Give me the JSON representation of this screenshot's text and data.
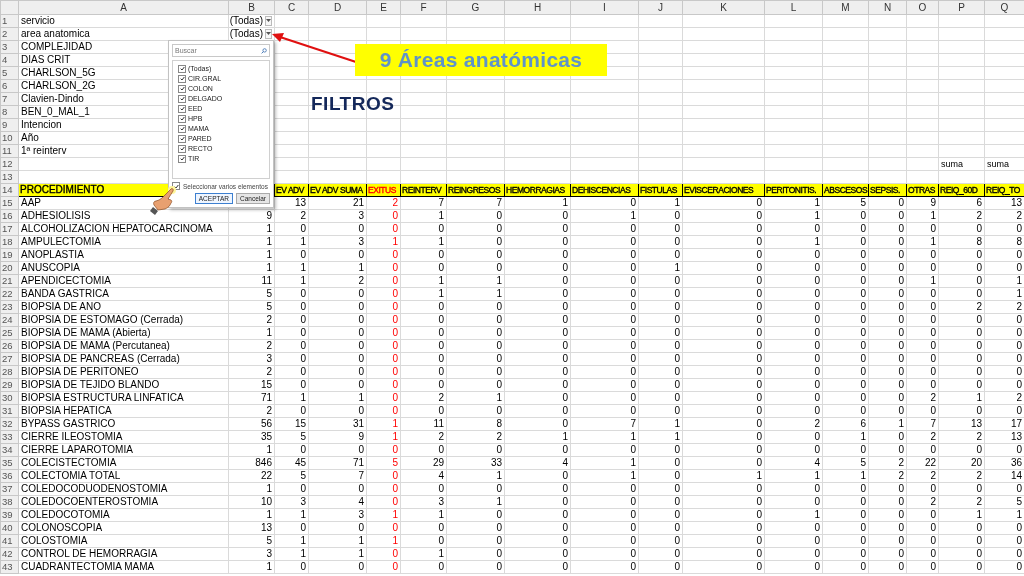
{
  "sheet": {
    "column_letters": [
      "A",
      "B",
      "C",
      "D",
      "E",
      "F",
      "G",
      "H",
      "I",
      "J",
      "K",
      "L",
      "M",
      "N",
      "O",
      "P",
      "Q"
    ]
  },
  "filters": [
    {
      "number": "1",
      "label": "servicio",
      "value": "(Todas)"
    },
    {
      "number": "2",
      "label": "area anatomica",
      "value": "(Todas)"
    },
    {
      "number": "3",
      "label": "COMPLEJIDAD"
    },
    {
      "number": "4",
      "label": "DIAS CRIT"
    },
    {
      "number": "5",
      "label": "CHARLSON_5G"
    },
    {
      "number": "6",
      "label": "CHARLSON_2G"
    },
    {
      "number": "7",
      "label": "Clavien-Dindo"
    },
    {
      "number": "8",
      "label": "BEN_0_MAL_1"
    },
    {
      "number": "9",
      "label": "Intencion"
    },
    {
      "number": "10",
      "label": "Año"
    },
    {
      "number": "11",
      "label": "1ª reinterv"
    }
  ],
  "row_12": {
    "number": "12",
    "values": [
      "suma",
      "suma"
    ]
  },
  "row_13": {
    "number": "13"
  },
  "table": {
    "header_number": "14",
    "header_label": "PROCEDIMIENTO",
    "columns": [
      {
        "label": "EV ADV",
        "flagged": false
      },
      {
        "label": "EV ADV SUMA",
        "flagged": false
      },
      {
        "label": "EXITUS",
        "flagged": true
      },
      {
        "label": "REINTERV",
        "flagged": false
      },
      {
        "label": "REINGRESOS",
        "flagged": false
      },
      {
        "label": "HEMORRAGIAS",
        "flagged": false
      },
      {
        "label": "DEHISCENCIAS",
        "flagged": false
      },
      {
        "label": "FISTULAS",
        "flagged": false
      },
      {
        "label": "EVISCERACIONES",
        "flagged": false
      },
      {
        "label": "PERITONITIS.",
        "flagged": false
      },
      {
        "label": "ABSCESOS",
        "flagged": false
      },
      {
        "label": "SEPSIS.",
        "flagged": false
      },
      {
        "label": "OTRAS",
        "flagged": false
      },
      {
        "label": "REIQ_60D",
        "flagged": false
      },
      {
        "label": "REIQ_TO",
        "flagged": false
      }
    ],
    "rows": [
      {
        "number": "15",
        "label": "AAP",
        "values": [
          "13",
          "21",
          "2",
          "7",
          "7",
          "1",
          "0",
          "1",
          "0",
          "1",
          "5",
          "0",
          "9",
          "6",
          "13"
        ]
      },
      {
        "number": "16",
        "label": "ADHESIOLISIS",
        "values": [
          "9",
          "2",
          "3",
          "0",
          "1",
          "0",
          "0",
          "1",
          "0",
          "0",
          "1",
          "0",
          "0",
          "1",
          "2",
          "2"
        ]
      },
      {
        "number": "17",
        "label": "ALCOHOLIZACION HEPATOCARCINOMA",
        "values": [
          "1",
          "0",
          "0",
          "0",
          "0",
          "0",
          "0",
          "0",
          "0",
          "0",
          "0",
          "0",
          "0",
          "0",
          "0",
          "0"
        ]
      },
      {
        "number": "18",
        "label": "AMPULECTOMIA",
        "values": [
          "1",
          "1",
          "3",
          "1",
          "1",
          "0",
          "0",
          "0",
          "0",
          "0",
          "1",
          "0",
          "0",
          "1",
          "8",
          "8"
        ]
      },
      {
        "number": "19",
        "label": "ANOPLASTIA",
        "values": [
          "1",
          "0",
          "0",
          "0",
          "0",
          "0",
          "0",
          "0",
          "0",
          "0",
          "0",
          "0",
          "0",
          "0",
          "0",
          "0"
        ]
      },
      {
        "number": "20",
        "label": "ANUSCOPIA",
        "values": [
          "1",
          "1",
          "1",
          "0",
          "0",
          "0",
          "0",
          "0",
          "1",
          "0",
          "0",
          "0",
          "0",
          "0",
          "0",
          "0"
        ]
      },
      {
        "number": "21",
        "label": "APENDICECTOMIA",
        "values": [
          "11",
          "1",
          "2",
          "0",
          "1",
          "1",
          "0",
          "0",
          "0",
          "0",
          "0",
          "0",
          "0",
          "1",
          "0",
          "1"
        ]
      },
      {
        "number": "22",
        "label": "BANDA GASTRICA",
        "values": [
          "5",
          "0",
          "0",
          "0",
          "1",
          "1",
          "0",
          "0",
          "0",
          "0",
          "0",
          "0",
          "0",
          "0",
          "0",
          "1"
        ]
      },
      {
        "number": "23",
        "label": "BIOPSIA DE ANO",
        "values": [
          "5",
          "0",
          "0",
          "0",
          "0",
          "0",
          "0",
          "0",
          "0",
          "0",
          "0",
          "0",
          "0",
          "0",
          "2",
          "2"
        ]
      },
      {
        "number": "24",
        "label": "BIOPSIA DE ESTOMAGO (Cerrada)",
        "values": [
          "2",
          "0",
          "0",
          "0",
          "0",
          "0",
          "0",
          "0",
          "0",
          "0",
          "0",
          "0",
          "0",
          "0",
          "0",
          "0"
        ]
      },
      {
        "number": "25",
        "label": "BIOPSIA DE MAMA (Abierta)",
        "values": [
          "1",
          "0",
          "0",
          "0",
          "0",
          "0",
          "0",
          "0",
          "0",
          "0",
          "0",
          "0",
          "0",
          "0",
          "0",
          "0"
        ]
      },
      {
        "number": "26",
        "label": "BIOPSIA DE MAMA (Percutanea)",
        "values": [
          "2",
          "0",
          "0",
          "0",
          "0",
          "0",
          "0",
          "0",
          "0",
          "0",
          "0",
          "0",
          "0",
          "0",
          "0",
          "0"
        ]
      },
      {
        "number": "27",
        "label": "BIOPSIA DE PANCREAS (Cerrada)",
        "values": [
          "3",
          "0",
          "0",
          "0",
          "0",
          "0",
          "0",
          "0",
          "0",
          "0",
          "0",
          "0",
          "0",
          "0",
          "0",
          "0"
        ]
      },
      {
        "number": "28",
        "label": "BIOPSIA DE PERITONEO",
        "values": [
          "2",
          "0",
          "0",
          "0",
          "0",
          "0",
          "0",
          "0",
          "0",
          "0",
          "0",
          "0",
          "0",
          "0",
          "0",
          "0"
        ]
      },
      {
        "number": "29",
        "label": "BIOPSIA DE TEJIDO BLANDO",
        "values": [
          "15",
          "0",
          "0",
          "0",
          "0",
          "0",
          "0",
          "0",
          "0",
          "0",
          "0",
          "0",
          "0",
          "0",
          "0",
          "0"
        ]
      },
      {
        "number": "30",
        "label": "BIOPSIA ESTRUCTURA LINFATICA",
        "values": [
          "71",
          "1",
          "1",
          "0",
          "2",
          "1",
          "0",
          "0",
          "0",
          "0",
          "0",
          "0",
          "0",
          "2",
          "1",
          "2"
        ]
      },
      {
        "number": "31",
        "label": "BIOPSIA HEPATICA",
        "values": [
          "2",
          "0",
          "0",
          "0",
          "0",
          "0",
          "0",
          "0",
          "0",
          "0",
          "0",
          "0",
          "0",
          "0",
          "0",
          "0"
        ]
      },
      {
        "number": "32",
        "label": "BYPASS GASTRICO",
        "values": [
          "56",
          "15",
          "31",
          "1",
          "11",
          "8",
          "0",
          "7",
          "1",
          "0",
          "2",
          "6",
          "1",
          "7",
          "13",
          "17"
        ]
      },
      {
        "number": "33",
        "label": "CIERRE ILEOSTOMIA",
        "values": [
          "35",
          "5",
          "9",
          "1",
          "2",
          "2",
          "1",
          "1",
          "1",
          "0",
          "0",
          "1",
          "0",
          "2",
          "2",
          "13"
        ]
      },
      {
        "number": "34",
        "label": "CIERRE LAPAROTOMIA",
        "values": [
          "1",
          "0",
          "0",
          "0",
          "0",
          "0",
          "0",
          "0",
          "0",
          "0",
          "0",
          "0",
          "0",
          "0",
          "0",
          "0"
        ]
      },
      {
        "number": "35",
        "label": "COLECISTECTOMIA",
        "values": [
          "846",
          "45",
          "71",
          "5",
          "29",
          "33",
          "4",
          "1",
          "0",
          "0",
          "4",
          "5",
          "2",
          "22",
          "20",
          "36"
        ]
      },
      {
        "number": "36",
        "label": "COLECTOMIA TOTAL",
        "values": [
          "22",
          "5",
          "7",
          "0",
          "4",
          "1",
          "0",
          "1",
          "0",
          "1",
          "1",
          "1",
          "2",
          "2",
          "2",
          "14"
        ]
      },
      {
        "number": "37",
        "label": "COLEDOCODUODENOSTOMIA",
        "values": [
          "1",
          "0",
          "0",
          "0",
          "0",
          "0",
          "0",
          "0",
          "0",
          "0",
          "0",
          "0",
          "0",
          "0",
          "0",
          "0"
        ]
      },
      {
        "number": "38",
        "label": "COLEDOCOENTEROSTOMIA",
        "values": [
          "10",
          "3",
          "4",
          "0",
          "3",
          "1",
          "0",
          "0",
          "0",
          "0",
          "0",
          "0",
          "0",
          "2",
          "2",
          "5"
        ]
      },
      {
        "number": "39",
        "label": "COLEDOCOTOMIA",
        "values": [
          "1",
          "1",
          "3",
          "1",
          "1",
          "0",
          "0",
          "0",
          "0",
          "0",
          "1",
          "0",
          "0",
          "0",
          "1",
          "1"
        ]
      },
      {
        "number": "40",
        "label": "COLONOSCOPIA",
        "values": [
          "13",
          "0",
          "0",
          "0",
          "0",
          "0",
          "0",
          "0",
          "0",
          "0",
          "0",
          "0",
          "0",
          "0",
          "0",
          "0"
        ]
      },
      {
        "number": "41",
        "label": "COLOSTOMIA",
        "values": [
          "5",
          "1",
          "1",
          "1",
          "0",
          "0",
          "0",
          "0",
          "0",
          "0",
          "0",
          "0",
          "0",
          "0",
          "0",
          "0"
        ]
      },
      {
        "number": "42",
        "label": "CONTROL DE HEMORRAGIA",
        "values": [
          "3",
          "1",
          "1",
          "0",
          "1",
          "0",
          "0",
          "0",
          "0",
          "0",
          "0",
          "0",
          "0",
          "0",
          "0",
          "0"
        ]
      },
      {
        "number": "43",
        "label": "CUADRANTECTOMIA MAMA",
        "values": [
          "1",
          "0",
          "0",
          "0",
          "0",
          "0",
          "0",
          "0",
          "0",
          "0",
          "0",
          "0",
          "0",
          "0",
          "0",
          "0"
        ]
      }
    ]
  },
  "filter_popup": {
    "search_placeholder": "Buscar",
    "options": [
      {
        "label": "(Todas)",
        "checked": true
      },
      {
        "label": "CIR.GRAL",
        "checked": true
      },
      {
        "label": "COLON",
        "checked": true
      },
      {
        "label": "DELGADO",
        "checked": true
      },
      {
        "label": "EED",
        "checked": true
      },
      {
        "label": "HPB",
        "checked": true
      },
      {
        "label": "MAMA",
        "checked": true
      },
      {
        "label": "PARED",
        "checked": true
      },
      {
        "label": "RECTO",
        "checked": true
      },
      {
        "label": "TIR",
        "checked": true
      }
    ],
    "multi_select": {
      "label": "Seleccionar varios elementos",
      "checked": true
    },
    "buttons": [
      {
        "label": "ACEPTAR",
        "kind": "primary"
      },
      {
        "label": "Cancelar",
        "kind": "secondary"
      }
    ]
  },
  "callout": {
    "text": "9 Áreas anatómicas"
  },
  "section_title": "FILTROS"
}
